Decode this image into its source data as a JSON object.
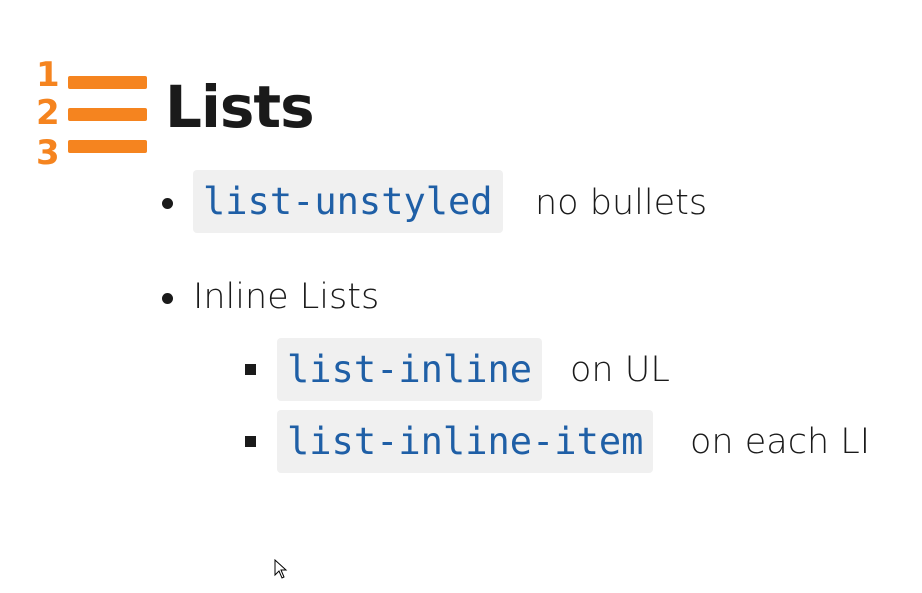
{
  "logo": {
    "numbers": [
      "1",
      "2",
      "3"
    ],
    "color": "#f5841f"
  },
  "title": "Lists",
  "items": [
    {
      "code": "list-unstyled",
      "text": "no bullets"
    },
    {
      "text": "Inline Lists",
      "subitems": [
        {
          "code": "list-inline",
          "text": "on UL"
        },
        {
          "code": "list-inline-item",
          "text": "on each LI"
        }
      ]
    }
  ]
}
